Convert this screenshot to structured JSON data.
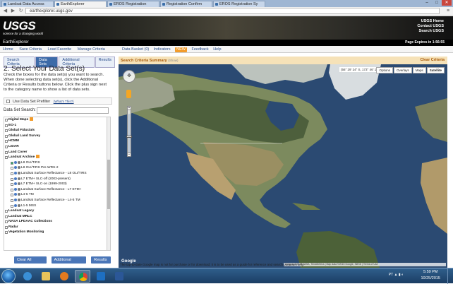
{
  "browser": {
    "tabs": [
      {
        "label": "Landsat Data Access"
      },
      {
        "label": "EarthExplorer",
        "active": true
      },
      {
        "label": "EROS Registration"
      },
      {
        "label": "Registration Confirm"
      },
      {
        "label": "EROS Registration Sy"
      }
    ],
    "url": "earthexplorer.usgs.gov"
  },
  "header": {
    "logo": "USGS",
    "slogan": "science for a changing world",
    "links": [
      "USGS Home",
      "Contact USGS",
      "Search USGS"
    ],
    "app_title": "EarthExplorer",
    "page_expires": "Page Expires in 1:56:55"
  },
  "menu": {
    "items": [
      "Home",
      "Save Criteria",
      "Load Favorite",
      "Manage Criteria"
    ],
    "right": {
      "basket": "Data Basket (0)",
      "indicators": "Indicators",
      "badge": "NEW",
      "feedback": "Feedback",
      "help": "Help"
    }
  },
  "left_panel": {
    "tabs": [
      "Search Criteria",
      "Data Sets",
      "Additional Criteria",
      "Results"
    ],
    "heading": "2. Select Your Data Set(s)",
    "instructions": "Check the boxes for the data set(s) you want to search. When done selecting data set(s), click the Additional Criteria or Results buttons below. Click the plus sign next to the category name to show a list of data sets.",
    "prefilter_label": "Use Data Set Prefilter",
    "prefilter_link": "(What's This?)",
    "search_label": "Data Set Search:",
    "tree": [
      {
        "label": "Digital Maps",
        "bold": true
      },
      {
        "label": "EO-1",
        "bold": true
      },
      {
        "label": "Global Fiducials",
        "bold": true
      },
      {
        "label": "Global Land Survey",
        "bold": true
      },
      {
        "label": "HCMM",
        "bold": true
      },
      {
        "label": "LIDAR",
        "bold": true
      },
      {
        "label": "Land Cover",
        "bold": true
      },
      {
        "label": "Landsat Archive",
        "bold": true
      },
      {
        "label": "L8 OLI/TIRS",
        "child": true,
        "checked": true
      },
      {
        "label": "L8 OLI/TIRS Pre-WRS-2",
        "child": true
      },
      {
        "label": "Landsat Surface Reflectance - L8 OLI/TIRS",
        "child": true
      },
      {
        "label": "L7 ETM+ SLC-off (2003-present)",
        "child": true
      },
      {
        "label": "L7 ETM+ SLC-on (1999-2003)",
        "child": true
      },
      {
        "label": "Landsat Surface Reflectance - L7 ETM+",
        "child": true
      },
      {
        "label": "L4-5 TM",
        "child": true
      },
      {
        "label": "Landsat Surface Reflectance - L4-5 TM",
        "child": true
      },
      {
        "label": "L1-5 MSS",
        "child": true
      },
      {
        "label": "Landsat Legacy",
        "bold": true
      },
      {
        "label": "Landsat MRLC",
        "bold": true
      },
      {
        "label": "NASA LPDAAC Collections",
        "bold": true
      },
      {
        "label": "Radar",
        "bold": true
      },
      {
        "label": "Vegetation Monitoring",
        "bold": true
      }
    ],
    "buttons": [
      "Clear All Selected",
      "Additional Criteria »",
      "Results »"
    ]
  },
  "map_panel": {
    "summary_title": "Search Criteria Summary",
    "summary_show": "(Show)",
    "clear": "Clear Criteria",
    "coords": "(56° 29' 24\" S, 173° 46' 15\" E)",
    "map_buttons": [
      "Options",
      "Overlays",
      "Maps",
      "Satellite"
    ],
    "attribution": "Imagery ©2015 NASA, TerraMetrics | Map data ©2015 Google, INEGI | Terms of Use",
    "google": "Google",
    "disclaimer": "The tap-to-date Google map is not for purchase or for download; it is to be used as a guide for reference and search purposes only."
  },
  "taskbar": {
    "time": "5:59 PM",
    "date": "10/25/2015",
    "lang": "PT"
  },
  "colors": {
    "accent": "#3c6aa8",
    "summary_bg": "#f6e2b8",
    "ocean": "#2b4a72"
  }
}
